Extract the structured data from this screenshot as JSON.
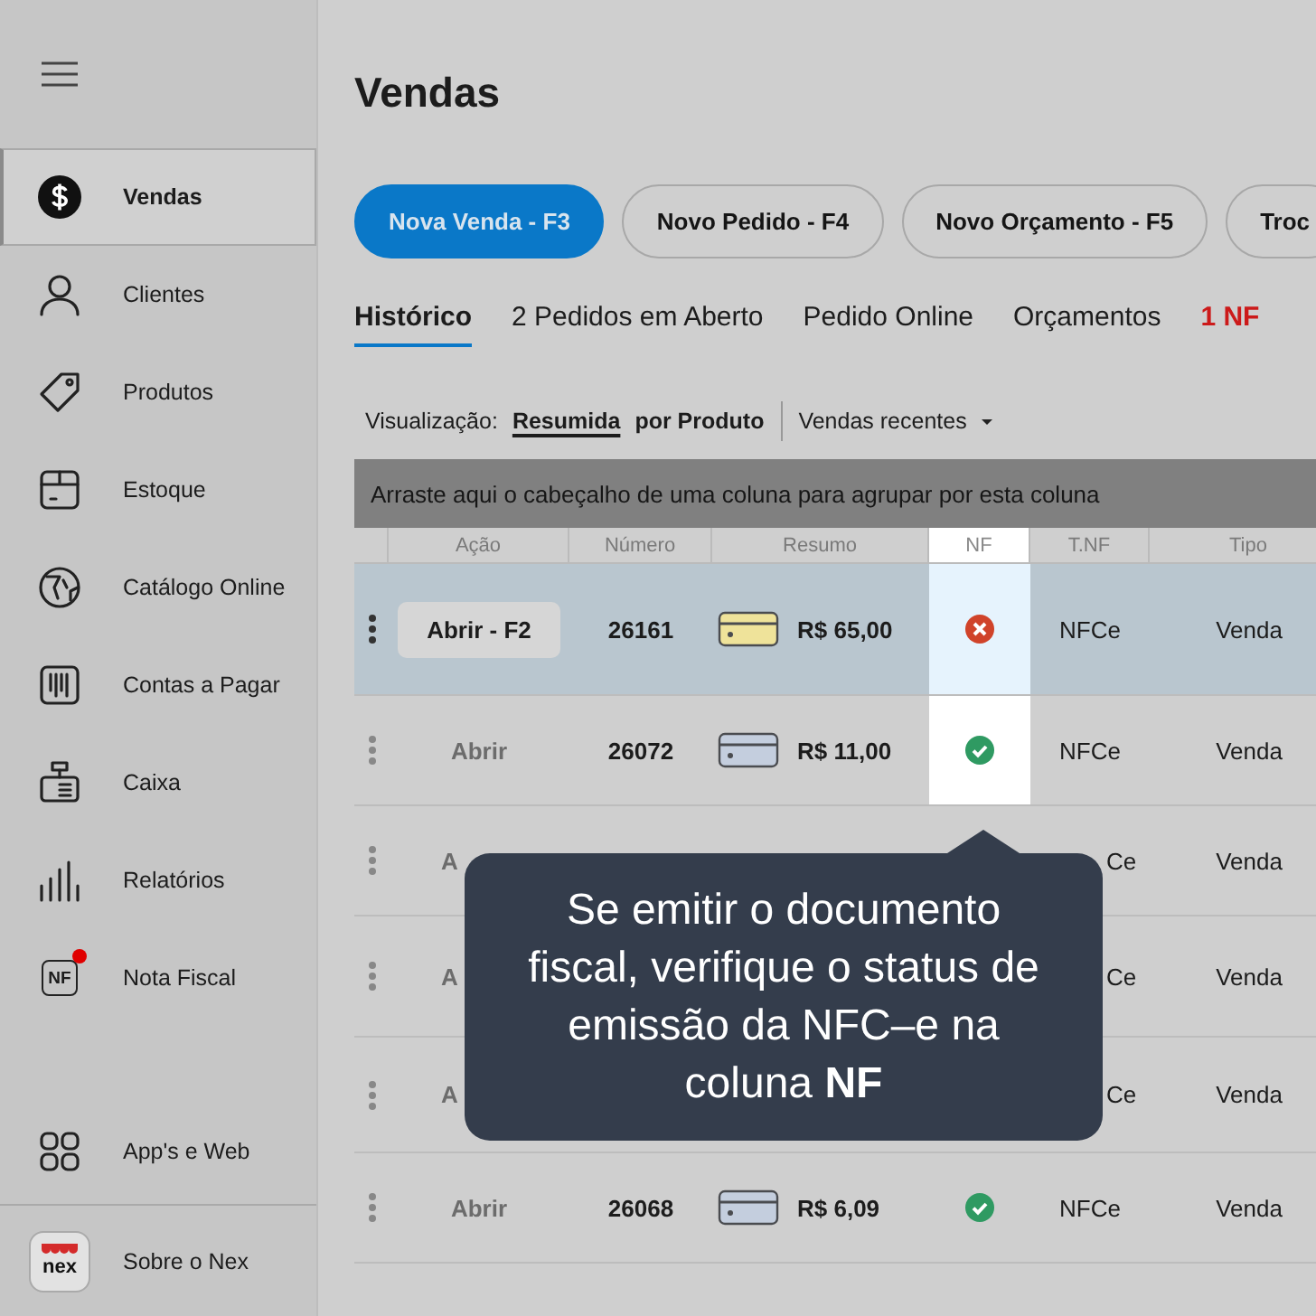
{
  "sidebar": {
    "items": [
      {
        "label": "Vendas",
        "selected": true,
        "badge": false
      },
      {
        "label": "Clientes",
        "selected": false,
        "badge": false
      },
      {
        "label": "Produtos",
        "selected": false,
        "badge": false
      },
      {
        "label": "Estoque",
        "selected": false,
        "badge": false
      },
      {
        "label": "Catálogo Online",
        "selected": false,
        "badge": false
      },
      {
        "label": "Contas a Pagar",
        "selected": false,
        "badge": false
      },
      {
        "label": "Caixa",
        "selected": false,
        "badge": false
      },
      {
        "label": "Relatórios",
        "selected": false,
        "badge": false
      },
      {
        "label": "Nota Fiscal",
        "icon_text": "NF",
        "selected": false,
        "badge": true
      }
    ],
    "bottom_items": [
      {
        "label": "App's e Web"
      },
      {
        "label": "Sobre o Nex",
        "icon_text": "nex"
      }
    ]
  },
  "title": "Vendas",
  "actions": [
    {
      "label": "Nova Venda - F3",
      "primary": true
    },
    {
      "label": "Novo Pedido - F4",
      "primary": false
    },
    {
      "label": "Novo Orçamento - F5",
      "primary": false
    },
    {
      "label": "Troc",
      "primary": false
    }
  ],
  "tabs": [
    {
      "label": "Histórico",
      "selected": true,
      "alert": false
    },
    {
      "label": "2 Pedidos em Aberto",
      "selected": false,
      "alert": false
    },
    {
      "label": "Pedido Online",
      "selected": false,
      "alert": false
    },
    {
      "label": "Orçamentos",
      "selected": false,
      "alert": false
    },
    {
      "label": "1 NF",
      "selected": false,
      "alert": true
    }
  ],
  "view": {
    "label": "Visualização:",
    "options": [
      {
        "label": "Resumida",
        "selected": true
      },
      {
        "label": "por Produto",
        "selected": false
      }
    ],
    "filter": "Vendas recentes"
  },
  "group_hint": "Arraste aqui o cabeçalho de uma coluna para agrupar por esta coluna",
  "table": {
    "columns": [
      "Ação",
      "Número",
      "Resumo",
      "NF",
      "T.NF",
      "Tipo"
    ],
    "rows": [
      {
        "selected": true,
        "covered": false,
        "action": "Abrir - F2",
        "number": "26161",
        "card": {
          "color": "#efe39a"
        },
        "amount": "R$ 65,00",
        "nf_ok": false,
        "tnf": "NFCe",
        "tipo": "Venda"
      },
      {
        "selected": false,
        "covered": false,
        "action": "Abrir",
        "number": "26072",
        "card": {
          "color": "#c4cede"
        },
        "amount": "R$ 11,00",
        "nf_ok": true,
        "tnf": "NFCe",
        "tipo": "Venda"
      },
      {
        "selected": false,
        "covered": true,
        "action": "A",
        "tnf": "Ce",
        "tipo": "Venda"
      },
      {
        "selected": false,
        "covered": true,
        "action": "A",
        "tnf": "Ce",
        "tipo": "Venda"
      },
      {
        "selected": false,
        "covered": true,
        "action": "A",
        "tnf": "Ce",
        "tipo": "Venda"
      },
      {
        "selected": false,
        "covered": false,
        "action": "Abrir",
        "number": "26068",
        "card": {
          "color": "#c4cede"
        },
        "amount": "R$ 6,09",
        "nf_ok": true,
        "tnf": "NFCe",
        "tipo": "Venda"
      }
    ]
  },
  "tooltip": {
    "text": "Se emitir o documento fiscal, verifique o status de emissão da NFC–e na coluna **NF**"
  }
}
